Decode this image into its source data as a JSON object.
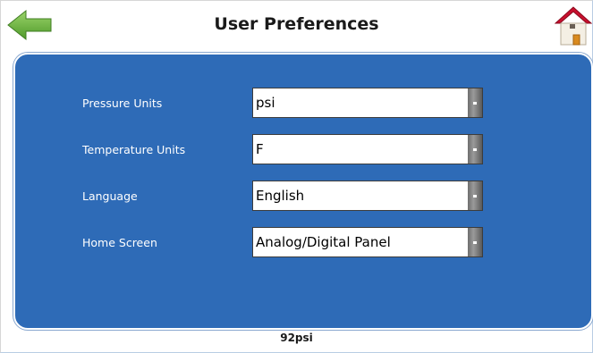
{
  "header": {
    "title": "User Preferences",
    "back_icon": "left-arrow-icon",
    "home_icon": "home-icon",
    "accent_green": "#6cb33f",
    "home_roof_red": "#c8102e"
  },
  "preferences": [
    {
      "label": "Pressure Units",
      "value": "psi"
    },
    {
      "label": "Temperature Units",
      "value": "F"
    },
    {
      "label": "Language",
      "value": "English"
    },
    {
      "label": "Home Screen",
      "value": "Analog/Digital Panel"
    }
  ],
  "panel_color": "#2e6bb7",
  "status": {
    "reading": "92psi"
  }
}
